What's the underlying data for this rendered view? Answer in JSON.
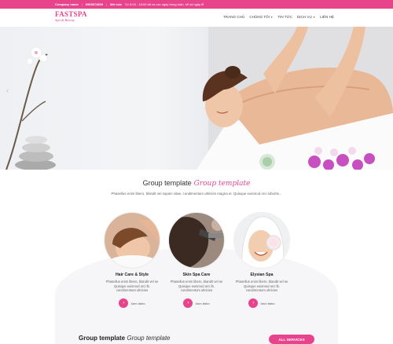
{
  "topbar": {
    "company_label": "Company name",
    "phone": "0969674820",
    "hours_label": "Mở cửa",
    "hours_text": "Từ 8:00 - 18:00 tất cả các ngày trong tuần, kể cả ngày lễ"
  },
  "logo": {
    "name": "FASTSPA",
    "tagline": "Spa & Beauty"
  },
  "nav": {
    "items": [
      {
        "label": "TRANG CHỦ"
      },
      {
        "label": "CHÚNG TÔI",
        "dropdown": true
      },
      {
        "label": "TIN TỨC"
      },
      {
        "label": "DỊCH VỤ",
        "dropdown": true
      },
      {
        "label": "LIÊN HỆ"
      }
    ]
  },
  "hero": {
    "prev_icon": "chevron-left-icon",
    "next_icon": "chevron-right-icon"
  },
  "section": {
    "title": "Group template",
    "title_script": "Group template",
    "description": "Phasellus enim libero, blandit vel sapien vitae, condimentum ultricies magna et. Quisque euismod orci lobortis..."
  },
  "services": [
    {
      "name": "Hair Care & Style",
      "desc": "Phasellus enim libero, blandit vel se Quisque euismod orci lb. condimentum ultricies",
      "more": "Xem thêm"
    },
    {
      "name": "Skin Spa Care",
      "desc": "Phasellus enim libero, blandit vel se Quisque euismod orci lb. condimentum ultricies",
      "more": "Xem thêm"
    },
    {
      "name": "Elysian Spa",
      "desc": "Phasellus enim libero, blandit vel se Quisque euismod orci lb. condimentum ultricies",
      "more": "Xem thêm"
    }
  ],
  "bottom": {
    "title": "Group template",
    "title_italic": "Group template",
    "button": "ALL SERVICES"
  },
  "colors": {
    "accent": "#e8448c"
  }
}
